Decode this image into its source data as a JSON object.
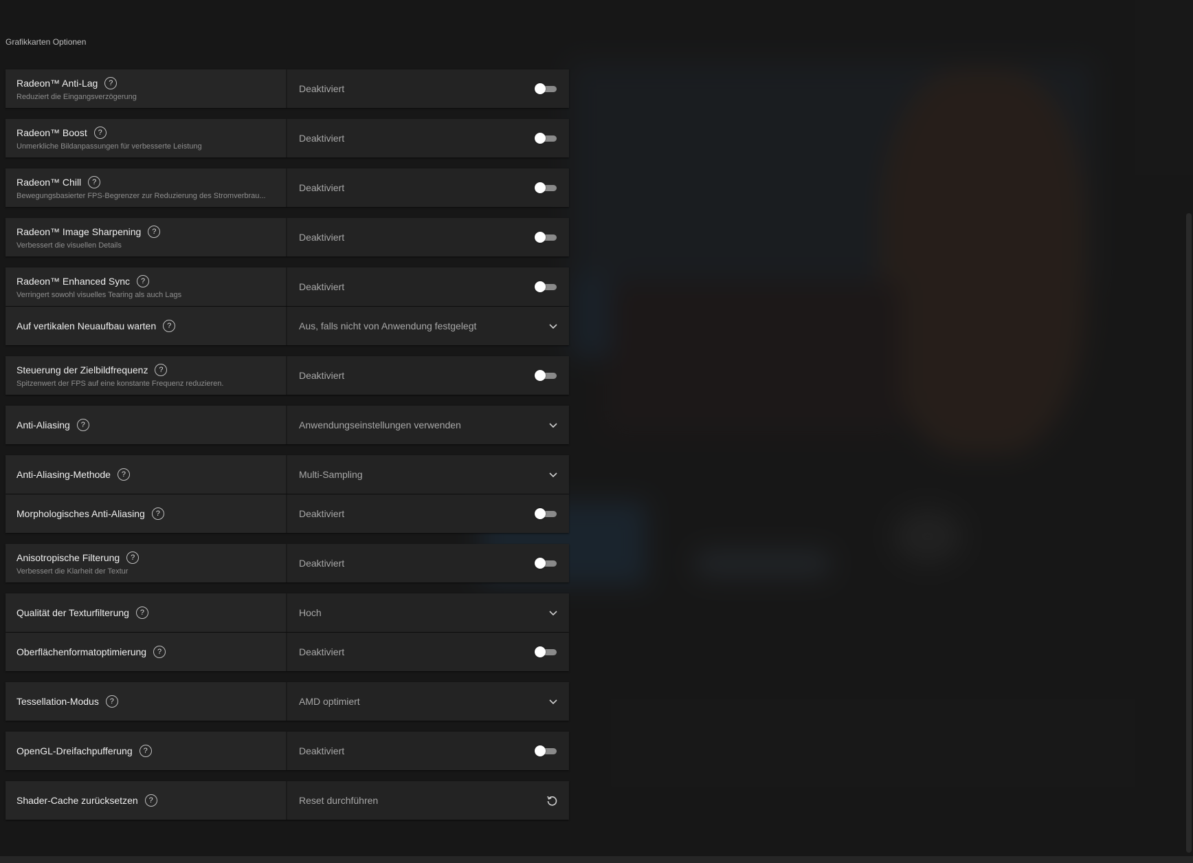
{
  "section_title": "Grafikkarten Optionen",
  "colors": {
    "background": "#1c1c1c",
    "row": "#262626",
    "toggle_track": "#8a8a8a",
    "toggle_knob": "#ffffff"
  },
  "rows": [
    {
      "label": "Radeon™ Anti-Lag",
      "desc": "Reduziert die Eingangsverzögerung",
      "value": "Deaktiviert",
      "control": "toggle",
      "on": false
    },
    {
      "label": "Radeon™ Boost",
      "desc": "Unmerkliche Bildanpassungen für verbesserte Leistung",
      "value": "Deaktiviert",
      "control": "toggle",
      "on": false
    },
    {
      "label": "Radeon™ Chill",
      "desc": "Bewegungsbasierter FPS-Begrenzer zur Reduzierung des Stromverbrau...",
      "value": "Deaktiviert",
      "control": "toggle",
      "on": false
    },
    {
      "label": "Radeon™ Image Sharpening",
      "desc": "Verbessert die visuellen Details",
      "value": "Deaktiviert",
      "control": "toggle",
      "on": false
    },
    {
      "label": "Radeon™ Enhanced Sync",
      "desc": "Verringert sowohl visuelles Tearing als auch Lags",
      "value": "Deaktiviert",
      "control": "toggle",
      "on": false
    },
    {
      "label": "Auf vertikalen Neuaufbau warten",
      "value": "Aus, falls nicht von Anwendung festgelegt",
      "control": "dropdown"
    },
    {
      "label": "Steuerung der Zielbildfrequenz",
      "desc": "Spitzenwert der FPS auf eine konstante Frequenz reduzieren.",
      "value": "Deaktiviert",
      "control": "toggle",
      "on": false
    },
    {
      "label": "Anti-Aliasing",
      "value": "Anwendungseinstellungen verwenden",
      "control": "dropdown"
    },
    {
      "label": "Anti-Aliasing-Methode",
      "value": "Multi-Sampling",
      "control": "dropdown"
    },
    {
      "label": "Morphologisches Anti-Aliasing",
      "value": "Deaktiviert",
      "control": "toggle",
      "on": false
    },
    {
      "label": "Anisotropische Filterung",
      "desc": "Verbessert die Klarheit der Textur",
      "value": "Deaktiviert",
      "control": "toggle",
      "on": false
    },
    {
      "label": "Qualität der Texturfilterung",
      "value": "Hoch",
      "control": "dropdown"
    },
    {
      "label": "Oberflächenformatoptimierung",
      "value": "Deaktiviert",
      "control": "toggle",
      "on": false
    },
    {
      "label": "Tessellation-Modus",
      "value": "AMD optimiert",
      "control": "dropdown"
    },
    {
      "label": "OpenGL-Dreifachpufferung",
      "value": "Deaktiviert",
      "control": "toggle",
      "on": false
    },
    {
      "label": "Shader-Cache zurücksetzen",
      "value": "Reset durchführen",
      "control": "reset"
    }
  ]
}
